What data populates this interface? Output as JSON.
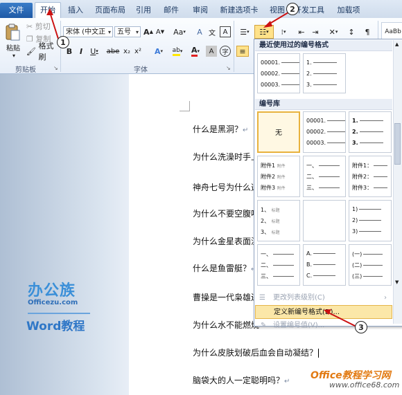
{
  "tabs": [
    {
      "label": "文件"
    },
    {
      "label": "开始"
    },
    {
      "label": "插入"
    },
    {
      "label": "页面布局"
    },
    {
      "label": "引用"
    },
    {
      "label": "邮件"
    },
    {
      "label": "审阅"
    },
    {
      "label": "新建选项卡"
    },
    {
      "label": "视图"
    },
    {
      "label": "开发工具"
    },
    {
      "label": "加载项"
    }
  ],
  "clipboard": {
    "paste": "粘贴",
    "cut": "剪切",
    "copy": "复制",
    "format_painter": "格式刷",
    "group_label": "剪贴板"
  },
  "font": {
    "family": "宋体 (中文正",
    "size": "五号",
    "group_label": "字体",
    "bold": "B",
    "italic": "I",
    "underline": "U",
    "strike": "abe",
    "sub": "x₂",
    "sup": "x²",
    "grow": "A",
    "shrink": "A",
    "case": "Aa",
    "clear": "A",
    "effects": "A",
    "highlight": "ab",
    "color": "A",
    "char_border": "A",
    "char_shade": "A",
    "enclose": "字"
  },
  "styles": {
    "preview": "AaBb"
  },
  "dropdown": {
    "recent_header": "最近使用过的编号格式",
    "recent": {
      "l1": "00001.",
      "l2": "00002.",
      "l3": "00003.",
      "r1": "1.",
      "r2": "2.",
      "r3": "3."
    },
    "library_header": "编号库",
    "none_label": "无",
    "lib": {
      "a1": "00001.",
      "a2": "00002.",
      "a3": "00003.",
      "b1": "1.",
      "b2": "2.",
      "b3": "3.",
      "c1": "附件1",
      "c2": "附件2",
      "c3": "附件3",
      "c_small": "附件",
      "d1": "一、",
      "d2": "二、",
      "d3": "三、",
      "e1": "附件1：",
      "e2": "附件2：",
      "e3": "附件3：",
      "f1": "1、",
      "f2": "2、",
      "f3": "3、",
      "f_small": "标题",
      "g1": "1)",
      "g2": "2)",
      "g3": "3)",
      "h1": "一、",
      "h2": "二、",
      "h3": "三、",
      "i1": "A.",
      "i2": "B.",
      "i3": "C.",
      "j1": "(一)",
      "j2": "(二)",
      "j3": "(三)"
    },
    "change_level": "更改列表级别(C)",
    "define_new": "定义新编号格式(D)...",
    "set_value": "设置编号值(V)..."
  },
  "document": {
    "paragraphs": [
      "什么是黑洞？",
      "为什么洗澡时手上",
      "神舟七号为什么选",
      "为什么不要空腹喝",
      "为什么金星表面温",
      "什么是鱼雷艇？",
      "曹操是一代枭雄还",
      "为什么水不能燃烧",
      "为什么皮肤划破后血会自动凝结？",
      "脑袋大的人一定聪明吗？"
    ],
    "para_mark": "↵"
  },
  "watermark": {
    "brand": "办公族",
    "url": "Officezu.com",
    "word": "Word教程",
    "site_title": "Office教程学习网",
    "site_url": "www.office68.com"
  },
  "callouts": {
    "one": "1",
    "two": "2",
    "three": "3"
  },
  "colors": {
    "accent": "#1f5aa6",
    "highlight": "#fff8e3",
    "selected_border": "#e8b23d",
    "callout_arrow": "#cc1111"
  }
}
